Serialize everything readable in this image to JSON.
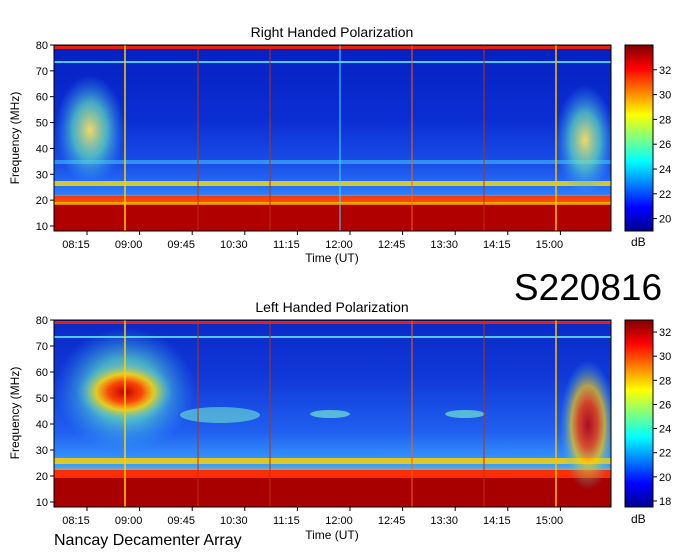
{
  "panels": [
    {
      "title": "Right Handed Polarization",
      "ylabel": "Frequency (MHz)",
      "xlabel": "Time (UT)",
      "yticks": [
        10,
        20,
        30,
        40,
        50,
        60,
        70,
        80
      ],
      "xticks": [
        "08:15",
        "09:00",
        "09:45",
        "10:30",
        "11:15",
        "12:00",
        "12:45",
        "13:30",
        "14:15",
        "15:00"
      ],
      "colorbar": {
        "ticks": [
          20,
          22,
          24,
          26,
          28,
          30,
          32
        ],
        "range": [
          19,
          34
        ],
        "unit": "dB"
      }
    },
    {
      "title": "Left Handed Polarization",
      "ylabel": "Frequency (MHz)",
      "xlabel": "Time (UT)",
      "yticks": [
        10,
        20,
        30,
        40,
        50,
        60,
        70,
        80
      ],
      "xticks": [
        "08:15",
        "09:00",
        "09:45",
        "10:30",
        "11:15",
        "12:00",
        "12:45",
        "13:30",
        "14:15",
        "15:00"
      ],
      "colorbar": {
        "ticks": [
          18,
          20,
          22,
          24,
          26,
          28,
          30,
          32
        ],
        "range": [
          17.5,
          33
        ],
        "unit": "dB"
      }
    }
  ],
  "event_label": "S220816",
  "footer_label": "Nancay Decamenter Array",
  "chart_data": [
    {
      "type": "heatmap",
      "title": "Right Handed Polarization",
      "xlabel": "Time (UT)",
      "ylabel": "Frequency (MHz)",
      "ylim": [
        10,
        80
      ],
      "color_unit": "dB",
      "color_range": [
        19,
        34
      ],
      "features": [
        {
          "desc": "strong low-frequency band",
          "freq_mhz": [
            10,
            23
          ],
          "level_db": 33
        },
        {
          "desc": "emission patch",
          "time": [
            "08:00",
            "08:50"
          ],
          "freq_mhz": [
            30,
            65
          ],
          "level_db": 26
        },
        {
          "desc": "emission patch",
          "time": [
            "15:00",
            "15:30"
          ],
          "freq_mhz": [
            27,
            62
          ],
          "level_db": 26
        }
      ]
    },
    {
      "type": "heatmap",
      "title": "Left Handed Polarization",
      "xlabel": "Time (UT)",
      "ylabel": "Frequency (MHz)",
      "ylim": [
        10,
        80
      ],
      "color_unit": "dB",
      "color_range": [
        17.5,
        33
      ],
      "features": [
        {
          "desc": "strong low-frequency band",
          "freq_mhz": [
            10,
            23
          ],
          "level_db": 32
        },
        {
          "desc": "intense emission patch",
          "time": [
            "08:00",
            "09:45"
          ],
          "freq_mhz": [
            35,
            68
          ],
          "level_db": 31
        },
        {
          "desc": "emission patch",
          "time": [
            "15:00",
            "15:40"
          ],
          "freq_mhz": [
            25,
            57
          ],
          "level_db": 29
        }
      ]
    }
  ]
}
